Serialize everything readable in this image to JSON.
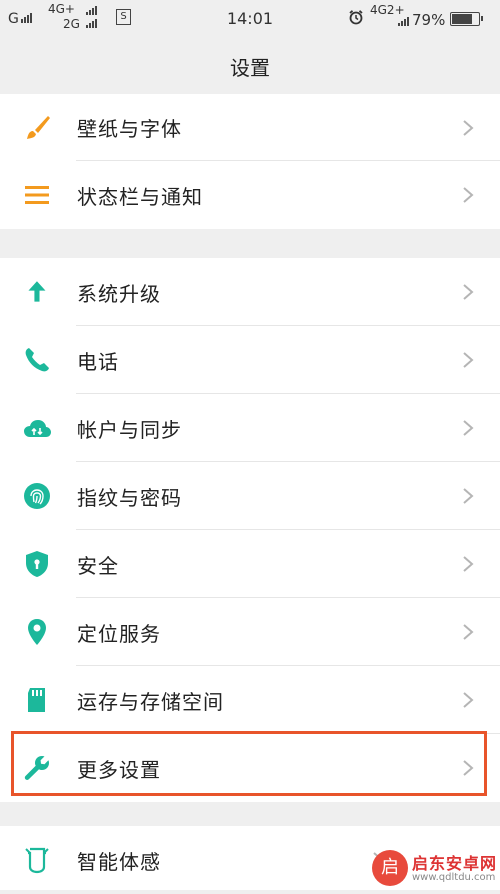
{
  "status_bar": {
    "carrier1": "G",
    "net1": "4G+",
    "net2": "2G",
    "sim_badge": "S",
    "time": "14:01",
    "net3": "4G2+",
    "battery_percent": "79%",
    "battery_level": 0.79,
    "icons": [
      "signal-icon",
      "sim-icon",
      "alarm-icon",
      "battery-icon"
    ]
  },
  "header": {
    "title": "设置"
  },
  "colors": {
    "orange": "#f39a1e",
    "teal": "#1cb89b",
    "highlight_border": "#e8542a"
  },
  "groups": [
    {
      "items": [
        {
          "label": "壁纸与字体",
          "icon": "paintbrush-icon"
        },
        {
          "label": "状态栏与通知",
          "icon": "list-icon"
        }
      ]
    },
    {
      "items": [
        {
          "label": "系统升级",
          "icon": "arrow-up-icon"
        },
        {
          "label": "电话",
          "icon": "phone-icon"
        },
        {
          "label": "帐户与同步",
          "icon": "cloud-sync-icon"
        },
        {
          "label": "指纹与密码",
          "icon": "fingerprint-icon"
        },
        {
          "label": "安全",
          "icon": "shield-icon"
        },
        {
          "label": "定位服务",
          "icon": "location-pin-icon"
        },
        {
          "label": "运存与存储空间",
          "icon": "sd-card-icon"
        },
        {
          "label": "更多设置",
          "icon": "wrench-icon"
        }
      ]
    },
    {
      "items": [
        {
          "label": "智能体感",
          "icon": "gesture-icon"
        }
      ]
    }
  ],
  "watermark": {
    "brand": "启东安卓网",
    "url": "www.qdltdu.com",
    "logo_glyph": "启"
  }
}
